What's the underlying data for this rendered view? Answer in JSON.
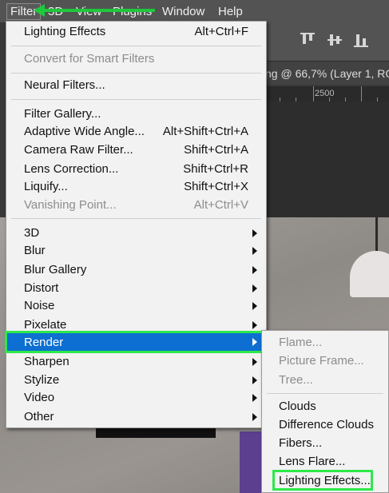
{
  "menubar": {
    "items": [
      "Filter",
      "3D",
      "View",
      "Plugins",
      "Window",
      "Help"
    ]
  },
  "doc_tab": {
    "title": "ng @ 66,7% (Layer 1, RG"
  },
  "ruler": {
    "label": "2500"
  },
  "filter_menu": {
    "last_filter": {
      "label": "Lighting Effects",
      "shortcut": "Alt+Ctrl+F"
    },
    "convert": {
      "label": "Convert for Smart Filters"
    },
    "neural": {
      "label": "Neural Filters..."
    },
    "filters": [
      {
        "label": "Filter Gallery...",
        "shortcut": ""
      },
      {
        "label": "Adaptive Wide Angle...",
        "shortcut": "Alt+Shift+Ctrl+A"
      },
      {
        "label": "Camera Raw Filter...",
        "shortcut": "Shift+Ctrl+A"
      },
      {
        "label": "Lens Correction...",
        "shortcut": "Shift+Ctrl+R"
      },
      {
        "label": "Liquify...",
        "shortcut": "Shift+Ctrl+X"
      },
      {
        "label": "Vanishing Point...",
        "shortcut": "Alt+Ctrl+V"
      }
    ],
    "groups": [
      "3D",
      "Blur",
      "Blur Gallery",
      "Distort",
      "Noise",
      "Pixelate",
      "Render",
      "Sharpen",
      "Stylize",
      "Video",
      "Other"
    ]
  },
  "render_submenu": {
    "disabled": [
      "Flame...",
      "Picture Frame...",
      "Tree..."
    ],
    "enabled": [
      "Clouds",
      "Difference Clouds",
      "Fibers...",
      "Lens Flare...",
      "Lighting Effects..."
    ]
  },
  "colors": {
    "highlight": "#0d6fd1",
    "annotation": "#2ee84a",
    "menu_bg": "#f2f2f2"
  }
}
